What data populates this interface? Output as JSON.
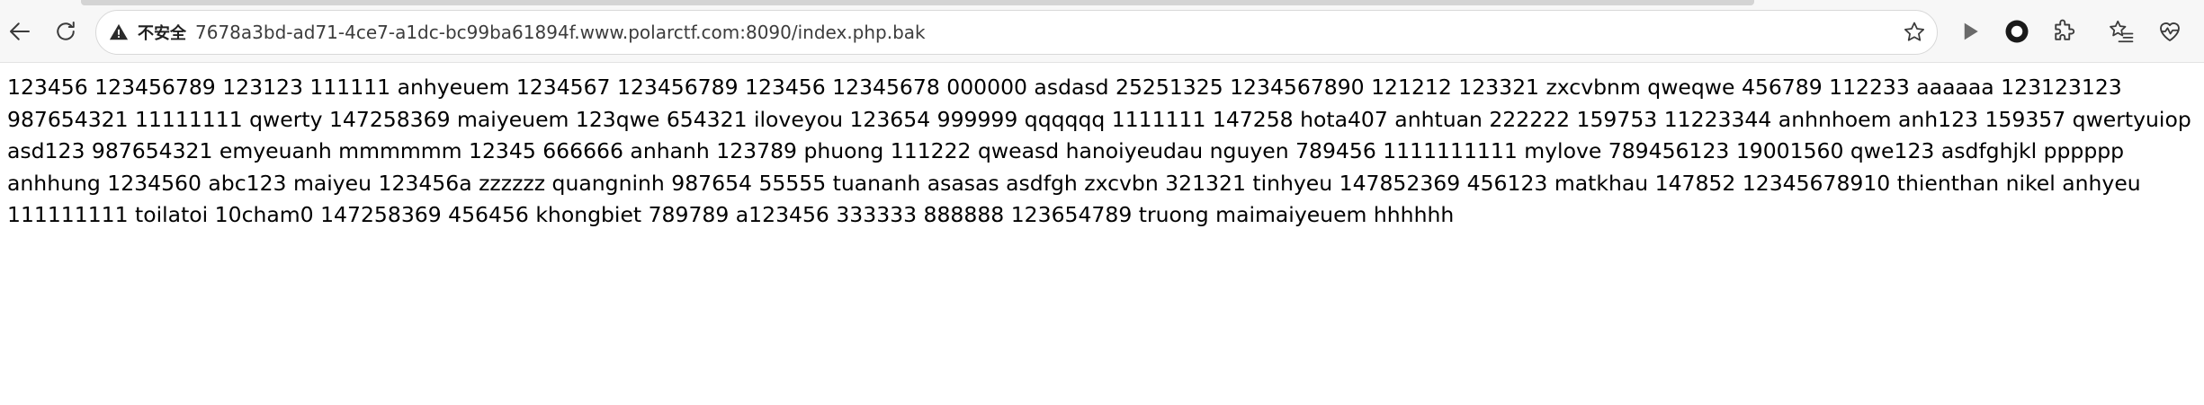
{
  "browser": {
    "security_label": "不安全",
    "url": "7678a3bd-ad71-4ce7-a1dc-bc99ba61894f.www.polarctf.com:8090/index.php.bak"
  },
  "page": {
    "text": "123456 123456789 123123 111111 anhyeuem 1234567 123456789 123456 12345678 000000 asdasd 25251325 1234567890 121212 123321 zxcvbnm qweqwe 456789 112233 aaaaaa 123123123 987654321 11111111 qwerty 147258369 maiyeuem 123qwe 654321 iloveyou 123654 999999 qqqqqq 1111111 147258 hota407 anhtuan 222222 159753 11223344 anhnhoem anh123 159357 qwertyuiop asd123 987654321 emyeuanh mmmmmm 12345 666666 anhanh 123789 phuong 111222 qweasd hanoiyeudau nguyen 789456 1111111111 mylove 789456123 19001560 qwe123 asdfghjkl pppppp anhhung 1234560 abc123 maiyeu 123456a zzzzzz quangninh 987654 55555 tuananh asasas asdfgh zxcvbn 321321 tinhyeu 147852369 456123 matkhau 147852 12345678910 thienthan nikel anhyeu 111111111 toilatoi 10cham0 147258369 456456 khongbiet 789789 a123456 333333 888888 123654789 truong maimaiyeuem hhhhhh"
  }
}
